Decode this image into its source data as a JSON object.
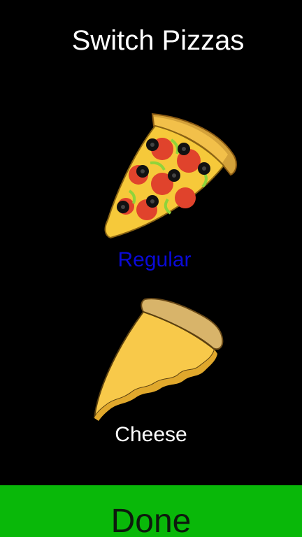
{
  "title": "Switch Pizzas",
  "options": [
    {
      "label": "Regular",
      "icon": "pepperoni-pizza-slice-icon",
      "selected": true
    },
    {
      "label": "Cheese",
      "icon": "cheese-pizza-slice-icon",
      "selected": false
    }
  ],
  "done_label": "Done",
  "colors": {
    "background": "#000000",
    "title": "#ffffff",
    "selected_label": "#0a0ad8",
    "unselected_label": "#ffffff",
    "done_button": "#09b809",
    "done_text": "#0d1a0d"
  }
}
